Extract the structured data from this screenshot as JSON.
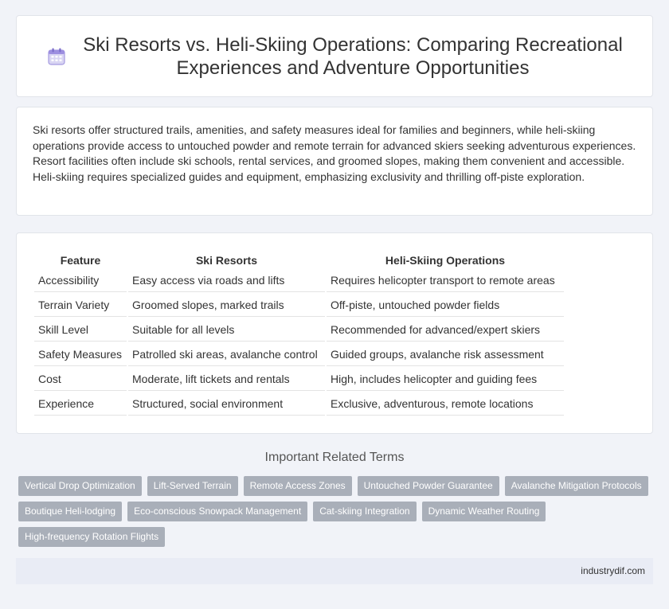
{
  "header": {
    "title": "Ski Resorts vs. Heli-Skiing Operations: Comparing Recreational Experiences and Adventure Opportunities",
    "icon": "calendar-icon"
  },
  "intro": {
    "text": "Ski resorts offer structured trails, amenities, and safety measures ideal for families and beginners, while heli-skiing operations provide access to untouched powder and remote terrain for advanced skiers seeking adventurous experiences. Resort facilities often include ski schools, rental services, and groomed slopes, making them convenient and accessible. Heli-skiing requires specialized guides and equipment, emphasizing exclusivity and thrilling off-piste exploration."
  },
  "table": {
    "headers": [
      "Feature",
      "Ski Resorts",
      "Heli-Skiing Operations"
    ],
    "rows": [
      [
        "Accessibility",
        "Easy access via roads and lifts",
        "Requires helicopter transport to remote areas"
      ],
      [
        "Terrain Variety",
        "Groomed slopes, marked trails",
        "Off-piste, untouched powder fields"
      ],
      [
        "Skill Level",
        "Suitable for all levels",
        "Recommended for advanced/expert skiers"
      ],
      [
        "Safety Measures",
        "Patrolled ski areas, avalanche control",
        "Guided groups, avalanche risk assessment"
      ],
      [
        "Cost",
        "Moderate, lift tickets and rentals",
        "High, includes helicopter and guiding fees"
      ],
      [
        "Experience",
        "Structured, social environment",
        "Exclusive, adventurous, remote locations"
      ]
    ]
  },
  "related": {
    "title": "Important Related Terms",
    "tags": [
      "Vertical Drop Optimization",
      "Lift-Served Terrain",
      "Remote Access Zones",
      "Untouched Powder Guarantee",
      "Avalanche Mitigation Protocols",
      "Boutique Heli-lodging",
      "Eco-conscious Snowpack Management",
      "Cat-skiing Integration",
      "Dynamic Weather Routing",
      "High-frequency Rotation Flights"
    ]
  },
  "footer": {
    "site": "industrydif.com"
  }
}
